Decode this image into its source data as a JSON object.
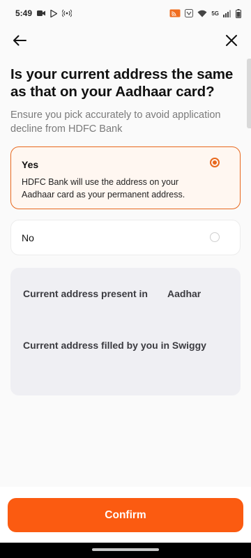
{
  "status_bar": {
    "time": "5:49",
    "network_label": "5G"
  },
  "nav": {
    "back_icon": "arrow-left-icon",
    "close_icon": "close-icon"
  },
  "header": {
    "title": "Is your current address the same as that on your Aadhaar card?",
    "subtitle": "Ensure you pick accurately to avoid application decline from HDFC Bank"
  },
  "options": [
    {
      "label": "Yes",
      "description": "HDFC Bank will use the address on your Aadhaar card as your permanent address.",
      "selected": true
    },
    {
      "label": "No",
      "selected": false
    }
  ],
  "address_info": {
    "present_label": "Current address present in",
    "present_value": "Aadhar",
    "filled_label": "Current address filled by you in Swiggy"
  },
  "footer": {
    "confirm_label": "Confirm"
  },
  "colors": {
    "accent": "#fb5b11",
    "selected_border": "#e8681d",
    "selected_bg": "#fff7f1"
  }
}
